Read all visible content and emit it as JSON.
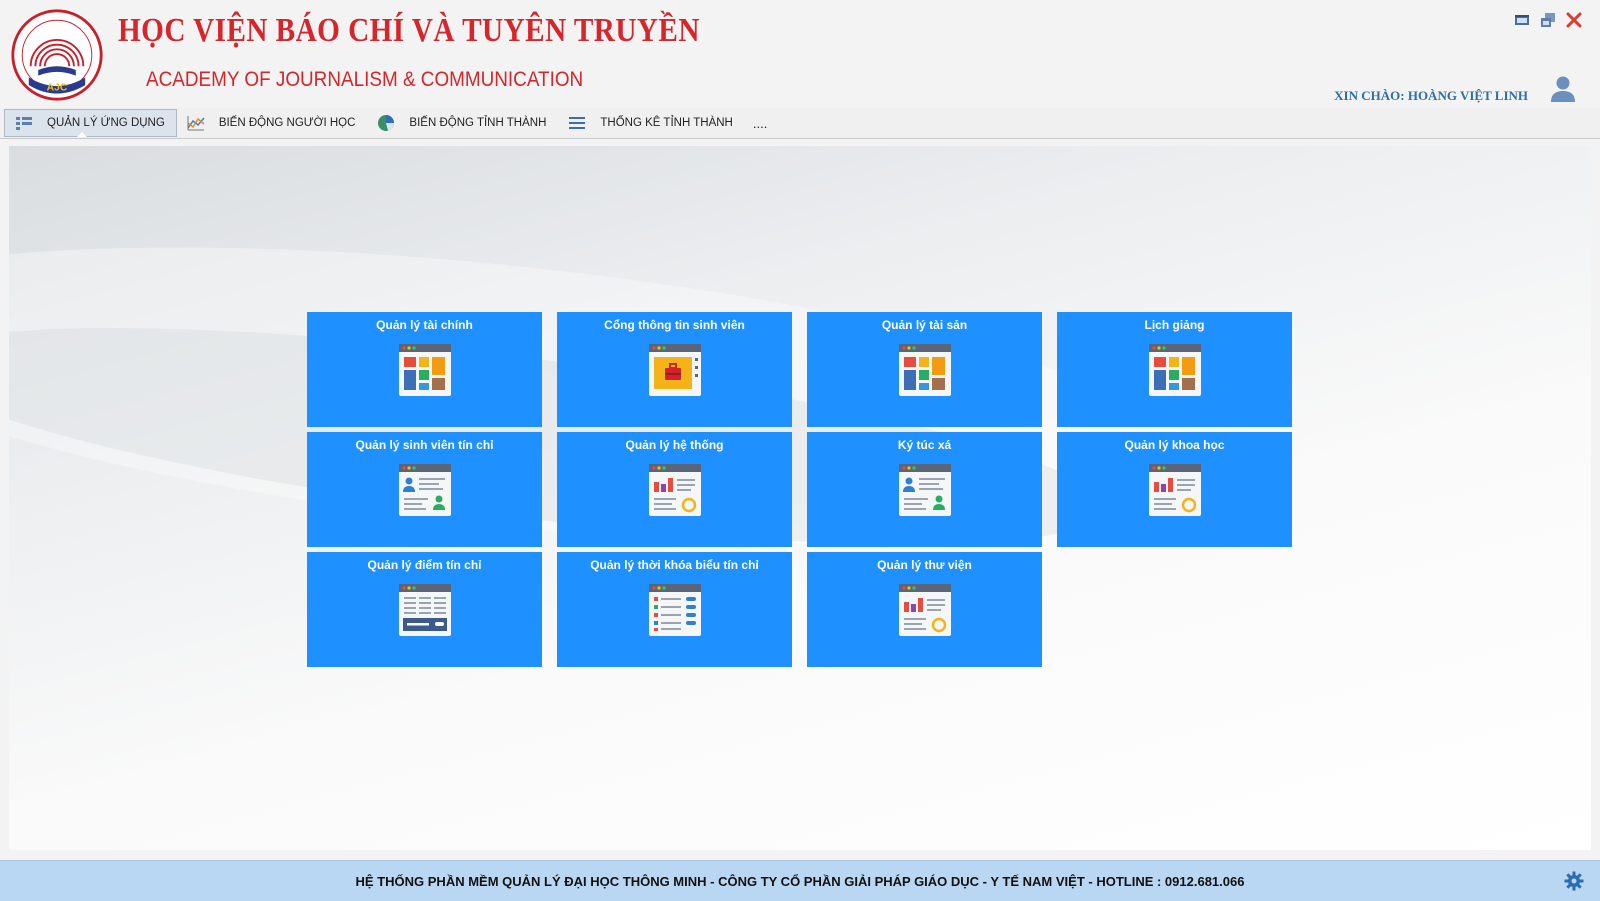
{
  "header": {
    "logo_text": "AJC",
    "logo_ring_text": "HỌC VIỆN BÁO CHÍ VÀ TUYÊN TRUYỀN",
    "title_vn": "HỌC VIỆN BÁO CHÍ VÀ TUYÊN TRUYỀN",
    "title_en": "ACADEMY OF JOURNALISM & COMMUNICATION",
    "greeting": "XIN CHÀO: HOÀNG VIỆT LINH",
    "window_controls": [
      "minimize-icon",
      "restore-icon",
      "close-icon"
    ]
  },
  "toolbar": {
    "tabs": [
      {
        "label": "QUẢN LÝ ỨNG DỤNG",
        "icon": "apps-grid-icon",
        "active": true
      },
      {
        "label": "BIẾN ĐỘNG NGƯỜI HỌC",
        "icon": "line-chart-icon",
        "active": false
      },
      {
        "label": "BIẾN ĐỘNG TỈNH THÀNH",
        "icon": "pie-chart-icon",
        "active": false
      },
      {
        "label": "THỐNG KÊ TỈNH THÀNH",
        "icon": "list-icon",
        "active": false
      }
    ],
    "more_label": "...."
  },
  "tiles": [
    {
      "label": "Quản lý tài chính",
      "icon": "dashboard-blocks-icon"
    },
    {
      "label": "Cổng thông tin sinh viên",
      "icon": "portal-bag-icon"
    },
    {
      "label": "Quản lý tài sản",
      "icon": "dashboard-blocks-icon"
    },
    {
      "label": "Lịch giảng",
      "icon": "dashboard-blocks-icon"
    },
    {
      "label": "Quản lý sinh viên tín chỉ",
      "icon": "user-profile-icon"
    },
    {
      "label": "Quản lý hệ thống",
      "icon": "chart-report-icon"
    },
    {
      "label": "Ký túc xá",
      "icon": "user-profile-icon"
    },
    {
      "label": "Quản lý khoa học",
      "icon": "chart-report-icon"
    },
    {
      "label": "Quản lý điểm tín chỉ",
      "icon": "table-grade-icon"
    },
    {
      "label": "Quản lý thời khóa biểu tín chỉ",
      "icon": "schedule-list-icon"
    },
    {
      "label": "Quản lý thư viện",
      "icon": "chart-report-icon"
    }
  ],
  "footer": {
    "text": "HỆ THỐNG PHẦN MỀM QUẢN LÝ ĐẠI HỌC THÔNG MINH - CÔNG TY CỔ PHẦN GIẢI PHÁP GIÁO DỤC - Y TẾ NAM VIỆT - HOTLINE : 0912.681.066"
  },
  "colors": {
    "brand_red": "#d6262b",
    "tile_blue": "#1e90ff",
    "greeting_blue": "#2d6fa8",
    "footer_bg": "#b9d7f2"
  }
}
